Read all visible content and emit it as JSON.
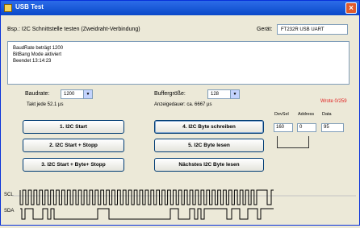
{
  "window": {
    "title": "USB Test",
    "close": "×"
  },
  "header": {
    "description": "Bsp.: I2C Schnittstelle testen (Zweidraht-Verbindung)",
    "device_label": "Gerät:",
    "device_value": "FT232R USB UART"
  },
  "log": {
    "lines": [
      "BaudRate beträgt 1200",
      "BitBang Mode aktiviert",
      "Beendet 13:14:23"
    ]
  },
  "baud": {
    "label": "Baudrate:",
    "value": "1200",
    "takt": "Takt jede 52.1 µs"
  },
  "buffer": {
    "label": "Buffergröße:",
    "value": "128",
    "anzeige": "Anzeigedauer: ca. 6667 µs"
  },
  "buttons": {
    "b1": "1. I2C Start",
    "b2": "2. I2C Start + Stopp",
    "b3": "3. I2C Start + Byte+ Stopp",
    "b4": "4. I2C Byte schreiben",
    "b5": "5. I2C Byte lesen",
    "b6": "Nächstes I2C Byte lesen"
  },
  "regs": {
    "warning": "Wrote 0/259",
    "devsel_label": "DevSel",
    "address_label": "Address",
    "data_label": "Data",
    "devsel_value": "160",
    "address_value": "0",
    "data_value": "95"
  },
  "signals": {
    "scl_label": "SCL",
    "sda_label": "SDA"
  }
}
